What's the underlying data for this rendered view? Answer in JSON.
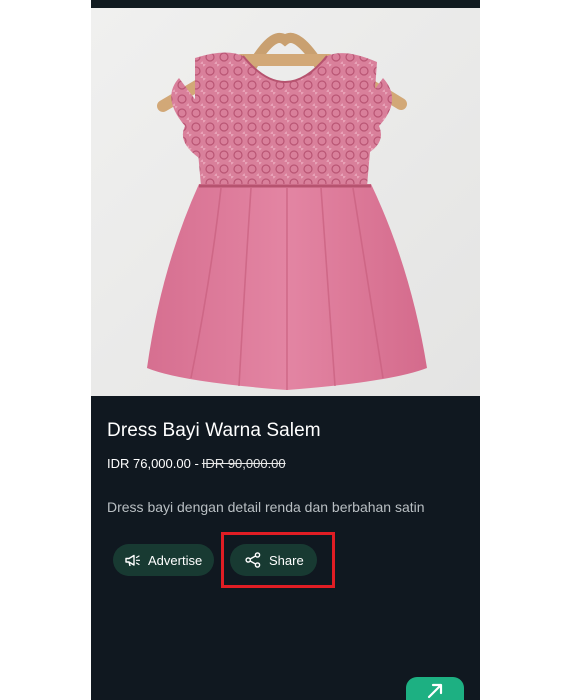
{
  "product": {
    "title": "Dress Bayi Warna Salem",
    "price": "IDR 76,000.00",
    "original_price": "IDR 90,000.00",
    "description": "Dress bayi dengan detail renda dan berbahan satin",
    "image_icon": "pink-lace-baby-dress-photo"
  },
  "actions": {
    "advertise_label": "Advertise",
    "advertise_icon": "megaphone-icon",
    "share_label": "Share",
    "share_icon": "share-icon"
  },
  "fab": {
    "icon": "arrow-up-icon"
  },
  "colors": {
    "background": "#0f1a21",
    "button_bg": "#183a32",
    "accent": "#1db082",
    "highlight": "#e11d24"
  }
}
